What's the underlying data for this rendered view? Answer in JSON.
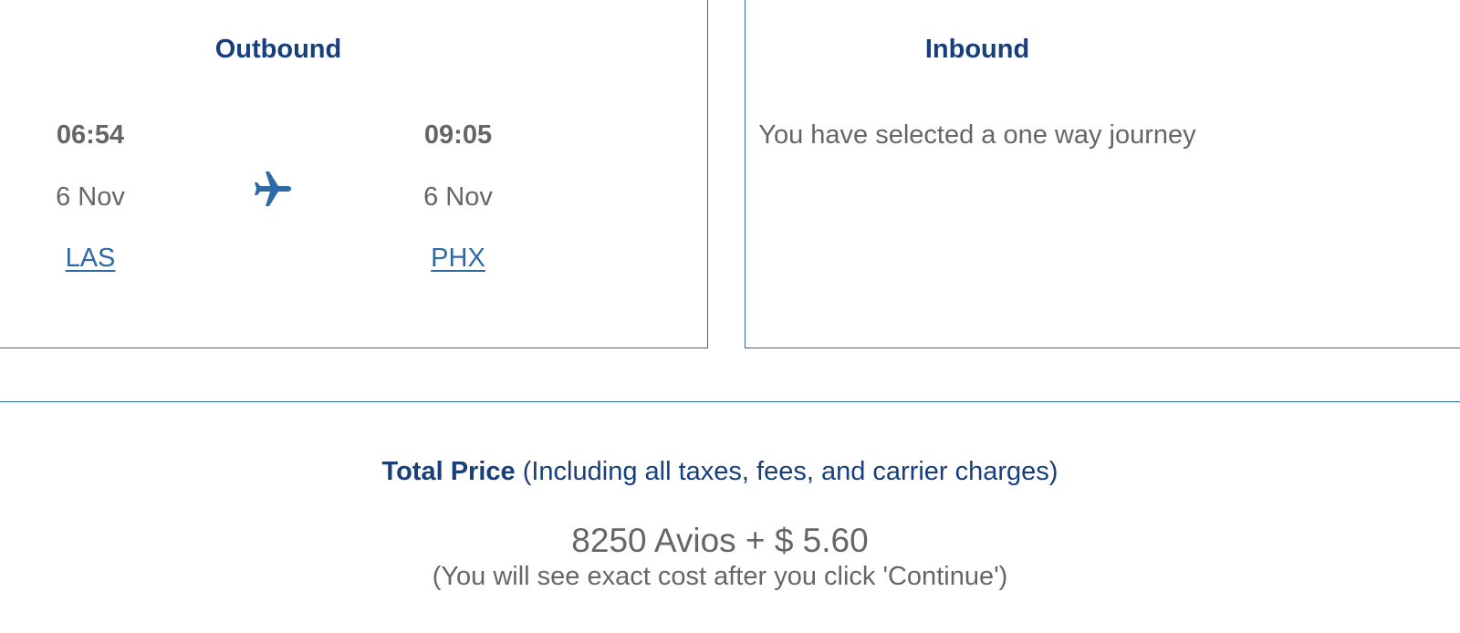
{
  "outbound": {
    "title": "Outbound",
    "departure": {
      "time": "06:54",
      "date": "6 Nov",
      "airport": "LAS"
    },
    "arrival": {
      "time": "09:05",
      "date": "6 Nov",
      "airport": "PHX"
    },
    "icon": "airplane-icon"
  },
  "inbound": {
    "title": "Inbound",
    "message": "You have selected a one way journey"
  },
  "total": {
    "label": "Total Price",
    "qualifier": "(Including all taxes, fees, and carrier charges)",
    "amount": "8250 Avios + $ 5.60",
    "note": "(You will see exact cost after you click 'Continue')"
  },
  "colors": {
    "border": "#2f6aa6",
    "heading": "#173f7d",
    "text": "#666666",
    "link": "#2f6aa6"
  }
}
